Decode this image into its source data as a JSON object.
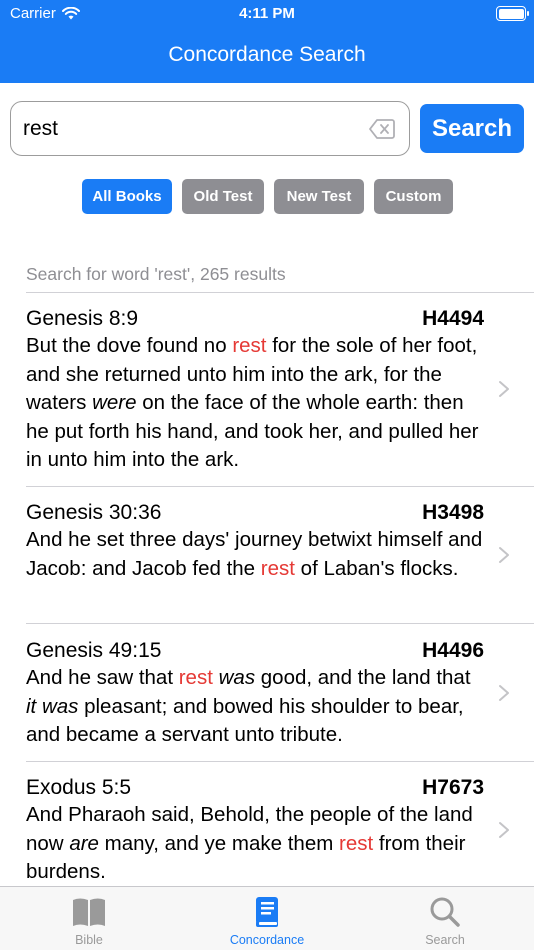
{
  "status_bar": {
    "carrier": "Carrier",
    "time": "4:11 PM"
  },
  "nav": {
    "title": "Concordance Search"
  },
  "search": {
    "value": "rest",
    "button_label": "Search"
  },
  "filters": [
    {
      "label": "All Books",
      "active": true
    },
    {
      "label": "Old Test",
      "active": false
    },
    {
      "label": "New Test",
      "active": false
    },
    {
      "label": "Custom",
      "active": false
    }
  ],
  "results_header": "Search for word 'rest', 265 results",
  "results": [
    {
      "reference": "Genesis 8:9",
      "strongs": "H4494",
      "segments": [
        {
          "t": "But the dove found no ",
          "s": "n"
        },
        {
          "t": "rest",
          "s": "h"
        },
        {
          "t": " for the sole of her foot, and she returned unto him into the ark, for the waters ",
          "s": "n"
        },
        {
          "t": "were",
          "s": "i"
        },
        {
          "t": " on the face of the whole earth: then he put forth his hand, and took her, and pulled her in unto him into the ark.",
          "s": "n"
        }
      ]
    },
    {
      "reference": "Genesis 30:36",
      "strongs": "H3498",
      "segments": [
        {
          "t": "And he set three days' journey betwixt himself and Jacob: and Jacob fed the ",
          "s": "n"
        },
        {
          "t": "rest",
          "s": "h"
        },
        {
          "t": " of Laban's flocks.",
          "s": "n"
        }
      ]
    },
    {
      "reference": "Genesis 49:15",
      "strongs": "H4496",
      "segments": [
        {
          "t": "And he saw that ",
          "s": "n"
        },
        {
          "t": "rest",
          "s": "h"
        },
        {
          "t": " ",
          "s": "n"
        },
        {
          "t": "was",
          "s": "i"
        },
        {
          "t": " good, and the land that ",
          "s": "n"
        },
        {
          "t": "it was",
          "s": "i"
        },
        {
          "t": " pleasant; and bowed his shoulder to bear, and became a servant unto tribute.",
          "s": "n"
        }
      ]
    },
    {
      "reference": "Exodus 5:5",
      "strongs": "H7673",
      "segments": [
        {
          "t": "And Pharaoh said, Behold, the people of the land now ",
          "s": "n"
        },
        {
          "t": "are",
          "s": "i"
        },
        {
          "t": " many, and ye make them ",
          "s": "n"
        },
        {
          "t": "rest",
          "s": "h"
        },
        {
          "t": " from their burdens.",
          "s": "n"
        }
      ]
    }
  ],
  "tabs": [
    {
      "label": "Bible",
      "icon": "book-icon",
      "active": false
    },
    {
      "label": "Concordance",
      "icon": "concordance-book-icon",
      "active": true
    },
    {
      "label": "Search",
      "icon": "magnifier-icon",
      "active": false
    }
  ],
  "colors": {
    "accent": "#1a7cf5",
    "highlight": "#e53935",
    "inactive_filter": "#8e8e93"
  }
}
